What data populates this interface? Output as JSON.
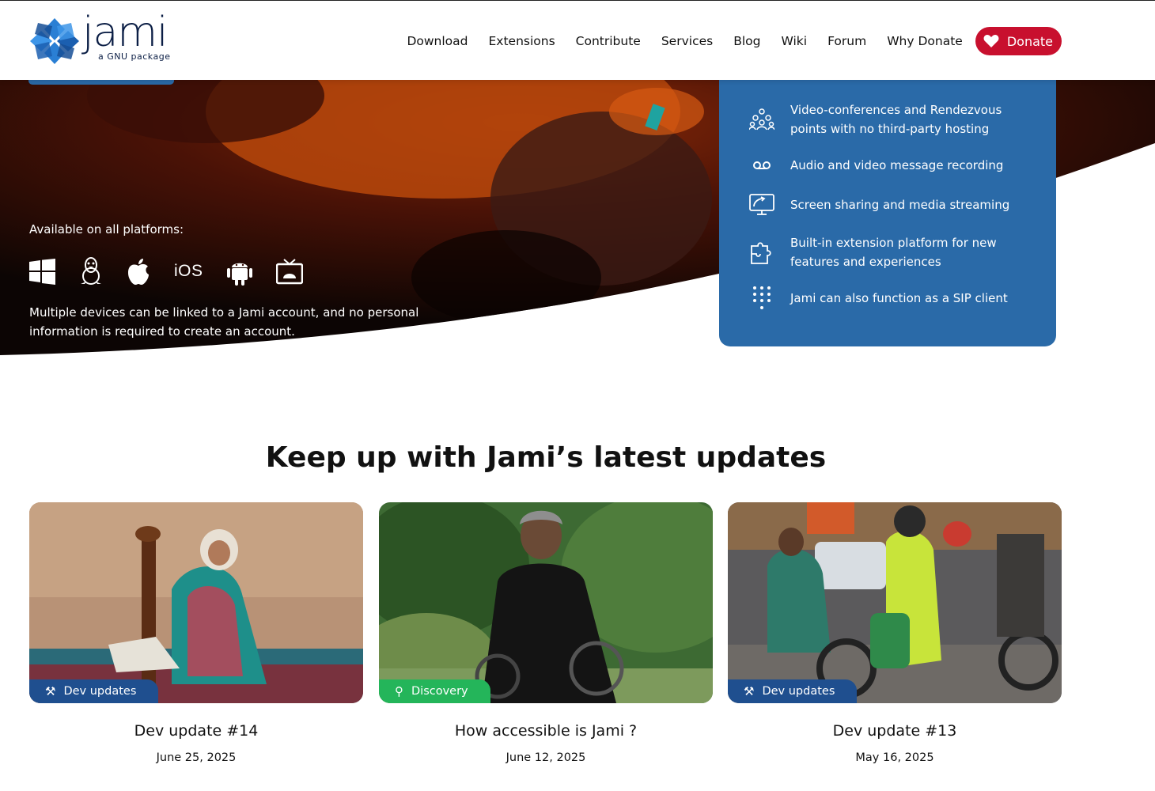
{
  "header": {
    "logo_word": "jami",
    "logo_tag": "a GNU package",
    "nav": [
      "Download",
      "Extensions",
      "Contribute",
      "Services",
      "Blog",
      "Wiki",
      "Forum",
      "Why Donate"
    ],
    "donate_label": "Donate",
    "colors": {
      "donate": "#c8102e",
      "logo": "#0b1e45",
      "logo_mark": "#2a7fd4"
    }
  },
  "hero": {
    "platforms_label": "Available on all platforms:",
    "platforms": [
      "windows-icon",
      "linux-icon",
      "apple-icon",
      "iOS",
      "android-icon",
      "android-tv-icon"
    ],
    "ios_label": "iOS",
    "description": "Multiple devices can be linked to a Jami account, and no personal information is required to create an account."
  },
  "features": {
    "color": "#2a6aa8",
    "items": [
      {
        "icon": "conference-icon",
        "text": "Video-conferences and Rendezvous points with no third-party hosting"
      },
      {
        "icon": "voicemail-icon",
        "text": "Audio and video message recording"
      },
      {
        "icon": "screen-share-icon",
        "text": "Screen sharing and media streaming"
      },
      {
        "icon": "puzzle-icon",
        "text": "Built-in extension platform for new features and experiences"
      },
      {
        "icon": "dialpad-icon",
        "text": "Jami can also function as a SIP client"
      }
    ]
  },
  "updates": {
    "title": "Keep up with Jami’s latest updates",
    "cards": [
      {
        "category": "Dev updates",
        "category_icon": "tools-icon",
        "title": "Dev update #14",
        "date": "June 25, 2025"
      },
      {
        "category": "Discovery",
        "category_icon": "magnifier-icon",
        "title": "How accessible is Jami ?",
        "date": "June 12, 2025"
      },
      {
        "category": "Dev updates",
        "category_icon": "tools-icon",
        "title": "Dev update #13",
        "date": "May 16, 2025"
      }
    ]
  }
}
